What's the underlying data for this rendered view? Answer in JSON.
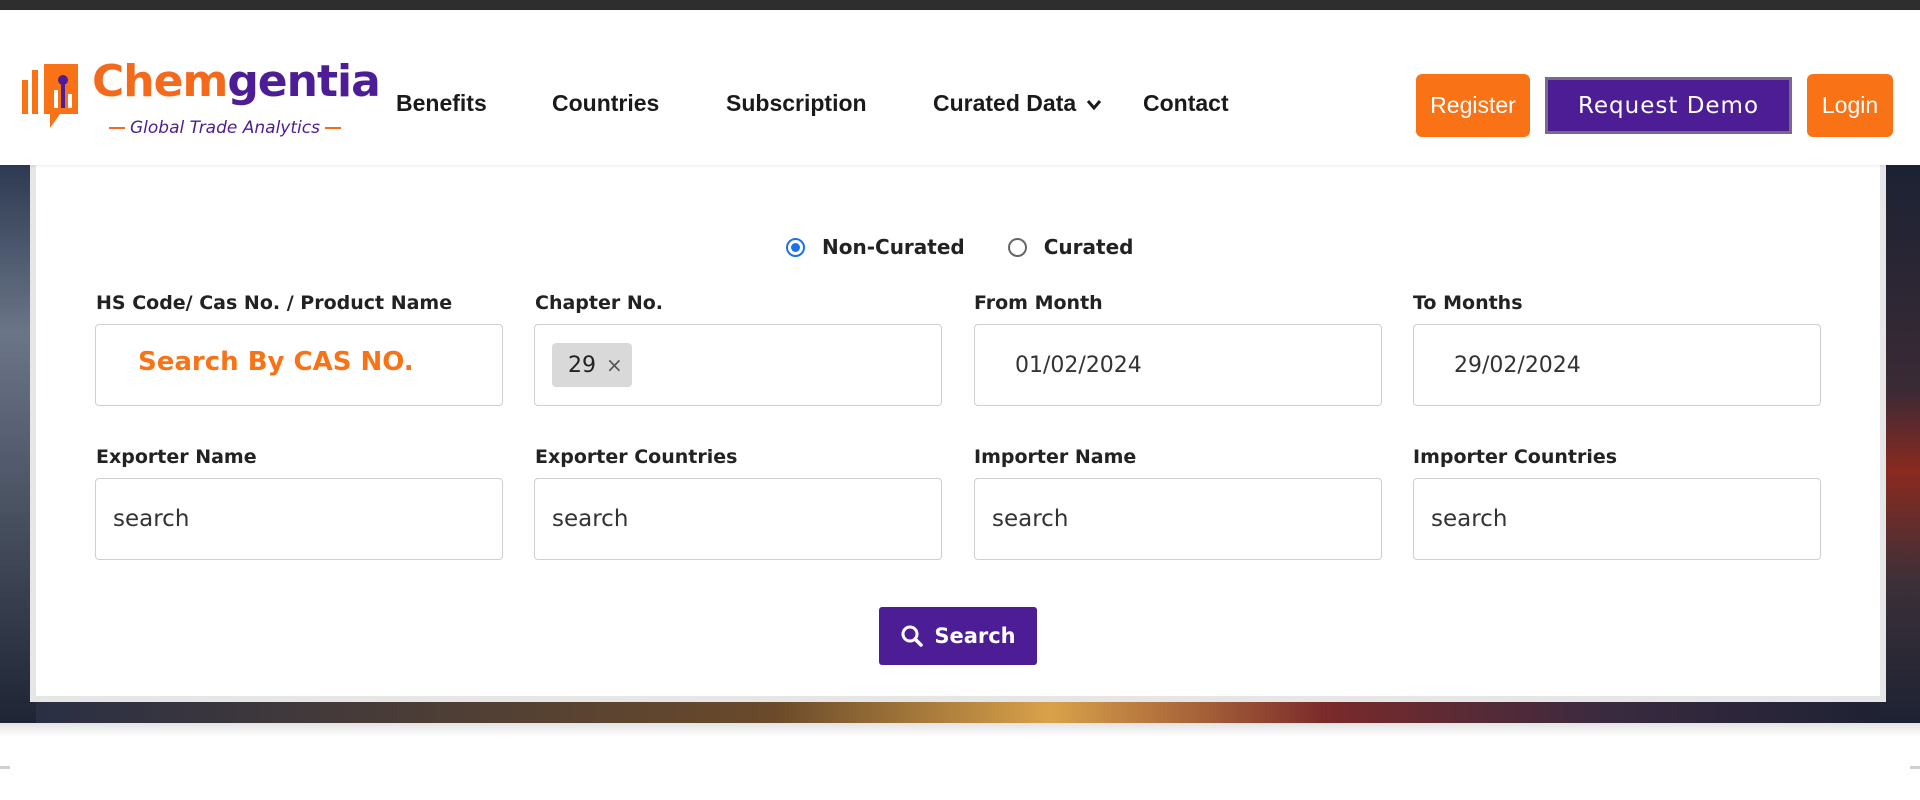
{
  "brand": {
    "name_part1": "Chem",
    "name_part2": "gentia",
    "tagline": "Global Trade Analytics",
    "primary_color": "#f97316",
    "secondary_color": "#4c1d95"
  },
  "nav": {
    "items": [
      {
        "label": "Benefits"
      },
      {
        "label": "Countries"
      },
      {
        "label": "Subscription"
      },
      {
        "label": "Curated Data"
      },
      {
        "label": "Contact"
      }
    ],
    "dropdown_icon": "chevron-down-icon"
  },
  "header_actions": {
    "register_label": "Register",
    "demo_label": "Request Demo",
    "login_label": "Login"
  },
  "form": {
    "data_type": {
      "options": [
        "Non-Curated",
        "Curated"
      ],
      "selected": "Non-Curated"
    },
    "hs_code": {
      "label": "HS Code/ Cas No. / Product Name",
      "placeholder": "Search By CAS NO."
    },
    "chapter": {
      "label": "Chapter No.",
      "selected_value": "29",
      "remove_glyph": "×"
    },
    "from_month": {
      "label": "From Month",
      "value": "01/02/2024"
    },
    "to_months": {
      "label": "To Months",
      "value": "29/02/2024"
    },
    "exporter_name": {
      "label": "Exporter Name",
      "placeholder": "search"
    },
    "exporter_countries": {
      "label": "Exporter Countries",
      "placeholder": "search"
    },
    "importer_name": {
      "label": "Importer Name",
      "placeholder": "search"
    },
    "importer_countries": {
      "label": "Importer Countries",
      "placeholder": "search"
    },
    "search_button": {
      "label": "Search",
      "icon": "search-icon"
    }
  }
}
